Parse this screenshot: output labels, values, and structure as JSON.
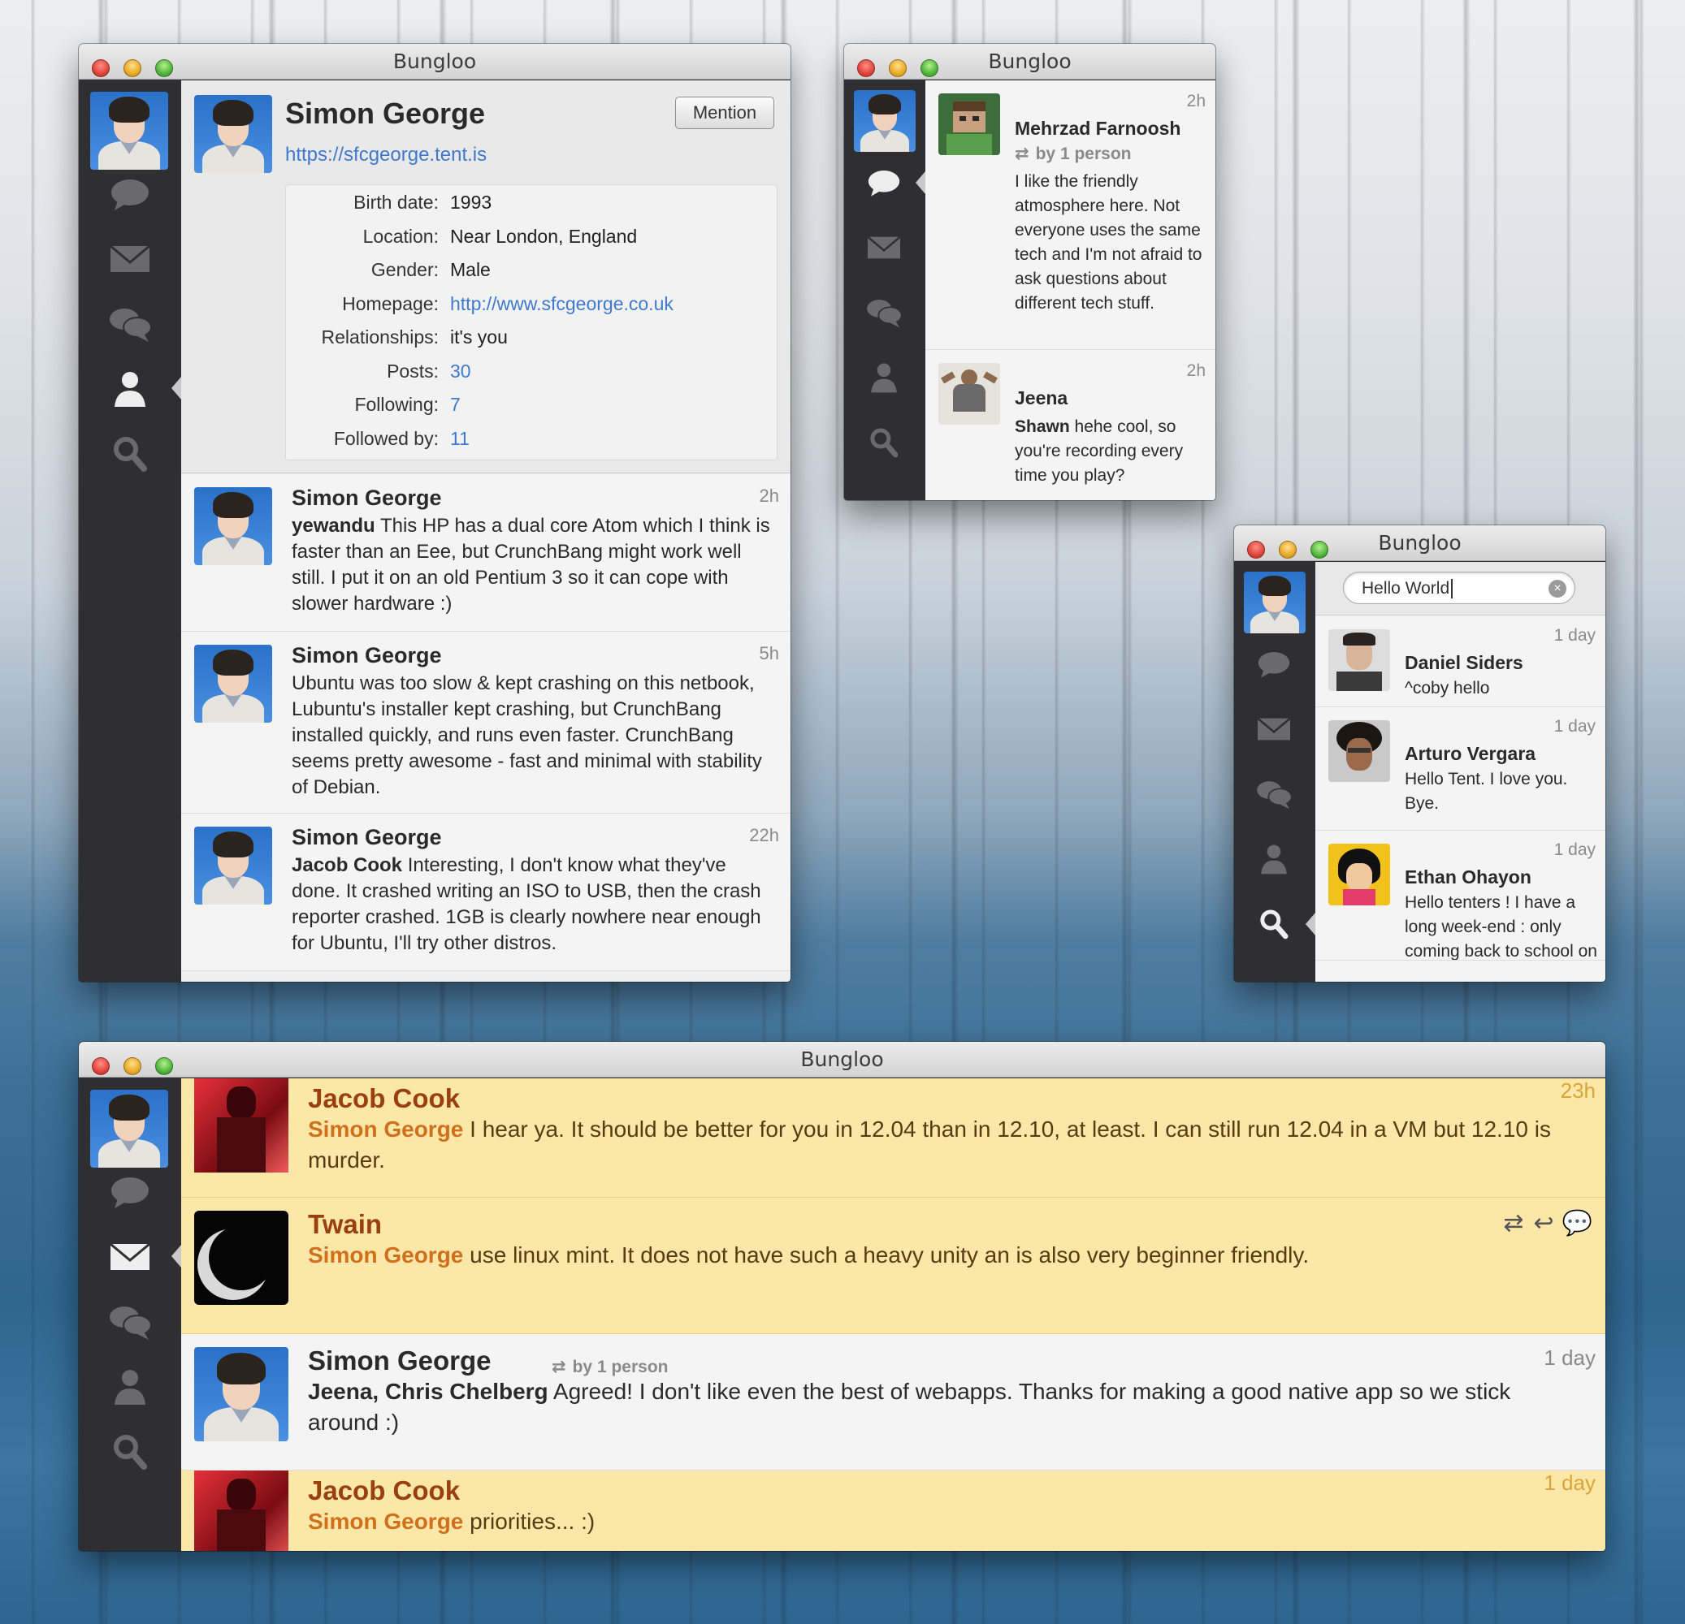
{
  "app_title": "Bungloo",
  "colors": {
    "highlight_bg": "#fbe7a7",
    "link": "#3f79cf",
    "mention": "#d0701d",
    "author_highlight": "#9a3f0e",
    "sidebar": "#2f2f31"
  },
  "sidebar_icons": [
    "chat-bubble-icon",
    "envelope-icon",
    "conversation-icon",
    "user-icon",
    "search-icon"
  ],
  "profile_window": {
    "name": "Simon George",
    "url": "https://sfcgeorge.tent.is",
    "mention_label": "Mention",
    "fields": [
      {
        "label": "Birth date:",
        "value": "1993"
      },
      {
        "label": "Location:",
        "value": "Near London, England"
      },
      {
        "label": "Gender:",
        "value": "Male"
      },
      {
        "label": "Homepage:",
        "value": "http://www.sfcgeorge.co.uk"
      },
      {
        "label": "Relationships:",
        "value": "it's you"
      },
      {
        "label": "Posts:",
        "value": "30"
      },
      {
        "label": "Following:",
        "value": "7"
      },
      {
        "label": "Followed by:",
        "value": "11"
      }
    ],
    "posts": [
      {
        "author": "Simon George",
        "time": "2h",
        "mention": "yewandu",
        "text": " This HP has a dual core Atom which I think is faster than an Eee, but CrunchBang might work well still. I put it on an old Pentium 3 so it can cope with slower hardware :)"
      },
      {
        "author": "Simon George",
        "time": "5h",
        "mention": "",
        "text": "Ubuntu was too slow & kept crashing on this netbook, Lubuntu's installer kept crashing, but CrunchBang installed quickly, and runs even faster. CrunchBang seems pretty awesome - fast and minimal with stability of Debian."
      },
      {
        "author": "Simon George",
        "time": "22h",
        "mention": "Jacob Cook",
        "text": " Interesting, I don't know what they've done. It crashed writing an ISO to USB, then the crash reporter crashed. 1GB is clearly nowhere near enough for Ubuntu, I'll try other distros."
      }
    ]
  },
  "timeline_window": {
    "posts": [
      {
        "author": "Mehrzad Farnoosh",
        "time": "2h",
        "repost": "by 1 person",
        "mention": "",
        "text": "I like the friendly atmosphere here. Not everyone uses the same tech and I'm not afraid to ask questions about different tech stuff."
      },
      {
        "author": "Jeena",
        "time": "2h",
        "repost": "",
        "mention": "Shawn",
        "text": " hehe cool, so you're recording every time you play?"
      }
    ]
  },
  "search_window": {
    "query": "Hello World",
    "results": [
      {
        "author": "Daniel Siders",
        "time": "1 day",
        "text": "^coby hello"
      },
      {
        "author": "Arturo Vergara",
        "time": "1 day",
        "text": "Hello Tent. I love you. Bye."
      },
      {
        "author": "Ethan Ohayon",
        "time": "1 day",
        "text": "Hello tenters ! I have a long week-end : only coming back to school on Monday"
      }
    ]
  },
  "mentions_window": {
    "posts": [
      {
        "author": "Jacob Cook",
        "time": "23h",
        "mention": "Simon George",
        "text": " I hear ya. It should be better for you in 12.04 than in 12.10, at least. I can still run 12.04 in a VM but 12.10 is murder.",
        "highlight": true
      },
      {
        "author": "Twain",
        "time": "",
        "mention": "Simon George",
        "text": " use linux mint. It does not have such a heavy unity an is also very beginner friendly.",
        "highlight": true
      },
      {
        "author": "Simon George",
        "time": "1 day",
        "repost": "by 1 person",
        "mention": "Jeena, Chris Chelberg",
        "text": " Agreed! I don't like even the best of webapps. Thanks for making a good native app so we stick around :)",
        "highlight": false
      },
      {
        "author": "Jacob Cook",
        "time": "1 day",
        "mention": "Simon George",
        "text": " priorities... :)",
        "highlight": true
      }
    ]
  }
}
